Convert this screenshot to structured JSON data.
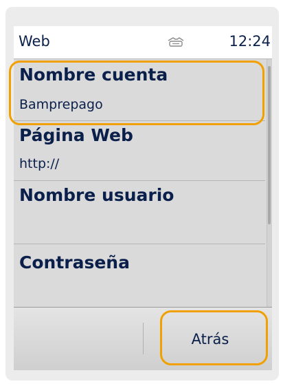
{
  "statusbar": {
    "title": "Web",
    "icon": "connection-icon",
    "time": "12:24"
  },
  "settings": {
    "items": [
      {
        "label": "Nombre cuenta",
        "value": "Bamprepago"
      },
      {
        "label": "Página Web",
        "value": "http://"
      },
      {
        "label": "Nombre usuario",
        "value": ""
      },
      {
        "label": "Contraseña",
        "value": ""
      }
    ]
  },
  "softkeys": {
    "left": "",
    "right": "Atrás"
  },
  "colors": {
    "text": "#0a1f4a",
    "highlight": "#f0a000",
    "list_background": "#dadada"
  }
}
